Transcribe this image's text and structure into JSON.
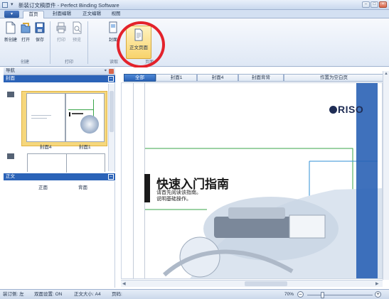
{
  "window": {
    "title": "新装订文稿原件 - Perfect Binding Software",
    "quick_access": "▾",
    "min": "–",
    "max": "□",
    "close": "×"
  },
  "tabs": {
    "app_menu": "▾",
    "items": [
      "首页",
      "封面编辑",
      "正文编辑",
      "视图"
    ]
  },
  "ribbon": {
    "buttons": [
      {
        "label": "新创建",
        "icon": "new-document-icon"
      },
      {
        "label": "打开",
        "icon": "open-folder-icon"
      },
      {
        "label": "保存",
        "icon": "save-icon"
      },
      {
        "label": "打印",
        "icon": "printer-icon"
      },
      {
        "label": "预览",
        "icon": "print-preview-icon"
      },
      {
        "label": "封面",
        "icon": "cover-page-icon"
      },
      {
        "label": "正文页面",
        "icon": "body-page-icon"
      }
    ],
    "groups": [
      "创建",
      "打印",
      "读取",
      "页面"
    ]
  },
  "nav": {
    "title": "导航",
    "pin": "⌖",
    "cover_section": "封面",
    "cover_labels": [
      "封面4",
      "封面1"
    ],
    "body_section": "正文",
    "body_columns": [
      "正面",
      "背面"
    ],
    "collapse": "–"
  },
  "page_tabs": [
    "全部",
    "封面1",
    "封面4",
    "封面背背",
    "作置为空白页"
  ],
  "document": {
    "brand": "RISO",
    "title": "快速入门指南",
    "subtitle_lines": [
      "请首先阅读该指南。",
      "说明基础操作。"
    ]
  },
  "status": {
    "binding": "装订侧: 左",
    "duplex": "双面设置: ON",
    "body_size": "正文大小: A4",
    "page": "页码:",
    "zoom": "70%",
    "zoom_out": "–",
    "zoom_in": "+"
  },
  "colors": {
    "accent": "#2b63b8",
    "highlight": "#e3222b",
    "selection": "#f6d77c",
    "green_line": "#3aa64a",
    "blue_line": "#2f8fd6"
  }
}
